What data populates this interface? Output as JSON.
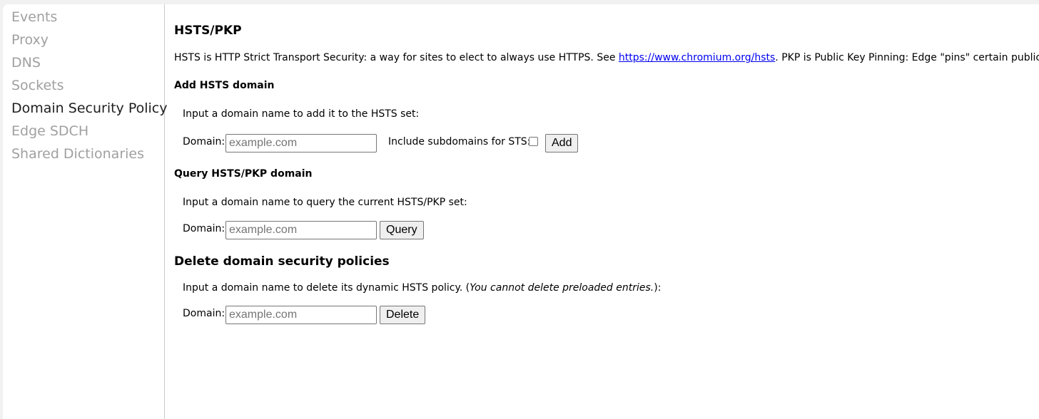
{
  "sidebar": {
    "items": [
      {
        "label": "Events",
        "selected": false
      },
      {
        "label": "Proxy",
        "selected": false
      },
      {
        "label": "DNS",
        "selected": false
      },
      {
        "label": "Sockets",
        "selected": false
      },
      {
        "label": "Domain Security Policy",
        "selected": true
      },
      {
        "label": "Edge SDCH",
        "selected": false
      },
      {
        "label": "Shared Dictionaries",
        "selected": false
      }
    ]
  },
  "main": {
    "title": "HSTS/PKP",
    "description": {
      "part1": "HSTS is HTTP Strict Transport Security: a way for sites to elect to always use HTTPS. See ",
      "link": "https://www.chromium.org/hsts",
      "part2": ". PKP is Public Key Pinning: Edge \"pins\" certain public keys for ce"
    },
    "add": {
      "heading": "Add HSTS domain",
      "instruction": "Input a domain name to add it to the HSTS set:",
      "domain_label": "Domain:",
      "placeholder": "example.com",
      "include_subdomains_label": "Include subdomains for STS:",
      "button_label": "Add"
    },
    "query": {
      "heading": "Query HSTS/PKP domain",
      "instruction": "Input a domain name to query the current HSTS/PKP set:",
      "domain_label": "Domain:",
      "placeholder": "example.com",
      "button_label": "Query"
    },
    "delete": {
      "heading": "Delete domain security policies",
      "instruction_part1": "Input a domain name to delete its dynamic HSTS policy. (",
      "instruction_italic": "You cannot delete preloaded entries.",
      "instruction_part2": "):",
      "domain_label": "Domain:",
      "placeholder": "example.com",
      "button_label": "Delete"
    }
  }
}
